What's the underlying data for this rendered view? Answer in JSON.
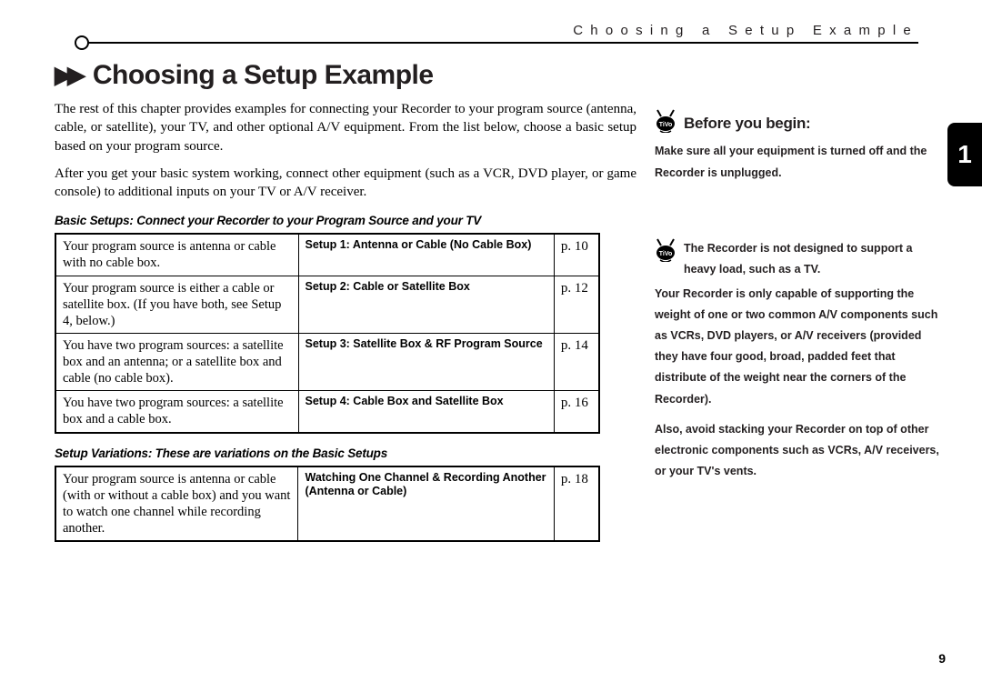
{
  "running_head": "Choosing a Setup Example",
  "title": "Choosing a Setup Example",
  "intro1": "The rest of this chapter provides examples for connecting your Recorder to your program source (antenna, cable, or satellite), your TV, and other optional A/V equipment. From the list below, choose a basic setup based on your program source.",
  "intro2": "After you get your basic system working, connect other equipment (such as a VCR, DVD player, or game console) to additional inputs on your TV or A/V receiver.",
  "basic_label": "Basic Setups: Connect your Recorder to your Program Source and your TV",
  "basic_rows": [
    {
      "desc": "Your program source is antenna or cable with no cable box.",
      "name": "Setup 1: Antenna or Cable (No Cable Box)",
      "page": "p. 10"
    },
    {
      "desc": "Your program source is either a cable or satellite box. (If you have both, see Setup 4, below.)",
      "name": "Setup 2: Cable or Satellite Box",
      "page": "p. 12"
    },
    {
      "desc": "You have two program sources: a satellite box and an antenna; or a satellite box and cable (no cable box).",
      "name": "Setup 3: Satellite Box & RF Program Source",
      "page": "p. 14"
    },
    {
      "desc": "You have two program sources: a satellite box and a cable box.",
      "name": "Setup 4: Cable Box and Satellite Box",
      "page": "p. 16"
    }
  ],
  "variations_label": "Setup Variations: These are variations on the Basic Setups",
  "variation_rows": [
    {
      "desc": "Your program source is antenna or cable (with or without a cable box) and you want to watch one channel while recording another.",
      "name": "Watching One Channel & Recording Another (Antenna or Cable)",
      "page": "p. 18"
    }
  ],
  "sidebar": {
    "before_begin": "Before you begin:",
    "before_text": "Make sure all your equipment is turned off and the Recorder is unplugged.",
    "note_lead": "The Recorder is not designed to support a heavy load, such as a TV.",
    "note_body": "Your Recorder is only capable of supporting the weight of one or two common A/V components such as VCRs, DVD players, or A/V receivers (provided they have four good, broad, padded feet that distribute of the weight near the corners of the Recorder).",
    "note_also": "Also, avoid stacking your Recorder on top of other electronic components such as VCRs, A/V receivers, or your TV's vents."
  },
  "chapter_number": "1",
  "page_number": "9"
}
